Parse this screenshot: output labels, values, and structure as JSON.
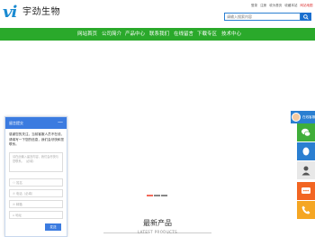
{
  "header": {
    "logo_mark": "vi",
    "company_name": "宇劲生物",
    "search": {
      "placeholder": "请输入搜索内容"
    },
    "top_links": [
      "登录",
      "注册",
      "收为首页",
      "收藏本站",
      "网站地图"
    ]
  },
  "nav": {
    "items": [
      "网站首页",
      "公司简介",
      "产品中心",
      "联系我们",
      "在线留言",
      "下载专区",
      "技术中心"
    ]
  },
  "banner": {
    "dots": [
      "#f26a5a",
      "#888888",
      "#888888"
    ]
  },
  "section": {
    "title": "最新产品",
    "subtitle": "LATEST PRODUCTS"
  },
  "chat": {
    "title": "留言提交",
    "minimize": "—",
    "message": "感谢您的关注，当前客服人员不在线，请填写一下您的信息，我们会尽快和您联系。",
    "textarea_placeholder": "请在此输入留言内容，我们会尽快与您联系。（必填）",
    "fields": [
      "姓名",
      "电话（必填）",
      "邮箱",
      "地址"
    ],
    "send_label": "发送"
  },
  "float_bar": {
    "online_label": "在线客服",
    "buttons": [
      {
        "icon": "wechat-icon",
        "color": "#3fae3a"
      },
      {
        "icon": "qq-icon",
        "color": "#2a7fd1"
      },
      {
        "icon": "user-icon",
        "color": "#e8e8e8"
      },
      {
        "icon": "message-icon",
        "color": "#f26522"
      },
      {
        "icon": "phone-icon",
        "color": "#f5a623"
      }
    ]
  },
  "colors": {
    "nav_green": "#2aa92b",
    "accent_blue": "#2a7fd1"
  }
}
